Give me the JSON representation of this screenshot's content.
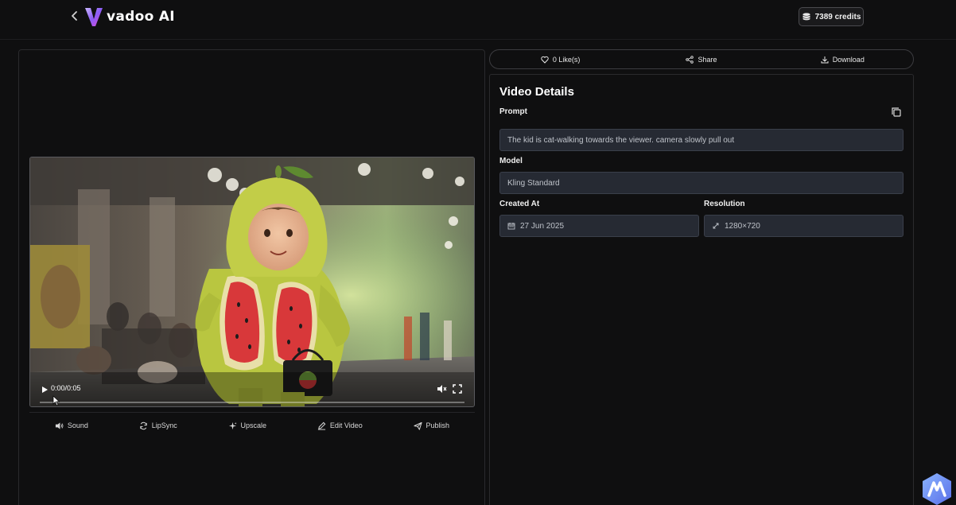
{
  "header": {
    "brand": "vadoo AI",
    "credits_label": "7389 credits"
  },
  "player": {
    "time": "0:00/0:05",
    "progress": 0
  },
  "toolbar": {
    "items": [
      {
        "label": "Sound",
        "icon": "speaker-icon"
      },
      {
        "label": "LipSync",
        "icon": "refresh-icon"
      },
      {
        "label": "Upscale",
        "icon": "sparkle-icon"
      },
      {
        "label": "Edit Video",
        "icon": "pencil-icon"
      },
      {
        "label": "Publish",
        "icon": "send-icon"
      }
    ]
  },
  "actions": {
    "like": "0 Like(s)",
    "share": "Share",
    "download": "Download"
  },
  "details": {
    "title": "Video Details",
    "prompt_label": "Prompt",
    "prompt_value": "The kid is cat-walking towards the viewer. camera slowly pull out",
    "model_label": "Model",
    "model_value": "Kling Standard",
    "created_label": "Created At",
    "created_value": "27 Jun 2025",
    "resolution_label": "Resolution",
    "resolution_value": "1280×720"
  },
  "colors": {
    "background": "#0f0f10",
    "field_bg": "#262a33",
    "brand_gradient": [
      "#7b5cff",
      "#e24bd8"
    ]
  }
}
